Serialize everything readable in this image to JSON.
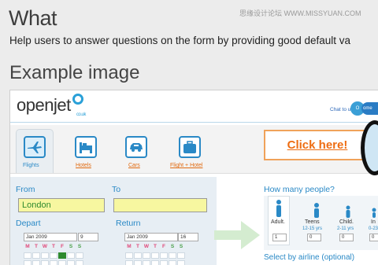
{
  "heading": "What",
  "watermark": "思缘设计论坛  WWW.MISSYUAN.COM",
  "description": "Help users to answer questions on the form by providing good default va",
  "subheading": "Example image",
  "site": {
    "logo": "openjet",
    "logo_sub": "co.uk",
    "chat_label": "Chat to us",
    "chat_badge_1": "O",
    "chat_badge_2": "ome",
    "banner": "Click here!"
  },
  "tabs": [
    {
      "label": "Flights",
      "icon": "plane-icon",
      "active": true
    },
    {
      "label": "Hotels",
      "icon": "bed-icon"
    },
    {
      "label": "Cars",
      "icon": "car-icon"
    },
    {
      "label": "Flight + Hotel",
      "icon": "suitcase-icon"
    }
  ],
  "form": {
    "from_label": "From",
    "from_value": "London",
    "to_label": "To",
    "to_value": "",
    "depart_label": "Depart",
    "depart_month": "Jan 2009",
    "depart_day": "9",
    "return_label": "Return",
    "return_month": "Jan 2009",
    "return_day": "16",
    "weekdays": [
      "M",
      "T",
      "W",
      "T",
      "F",
      "S",
      "S"
    ]
  },
  "people": {
    "label": "How many people?",
    "adult": "Adult.",
    "adult_count": "1",
    "teens": "Teens",
    "teens_age": "12-15 yrs",
    "teens_count": "0",
    "child": "Child.",
    "child_age": "2-11 yrs",
    "child_count": "0",
    "infant": "In",
    "infant_age": "0-23",
    "infant_count": "0"
  },
  "airline_label": "Select by airline (optional)",
  "colors": {
    "accent": "#2a89c6",
    "orange": "#ee6d12",
    "highlight": "#f7f7a0"
  }
}
